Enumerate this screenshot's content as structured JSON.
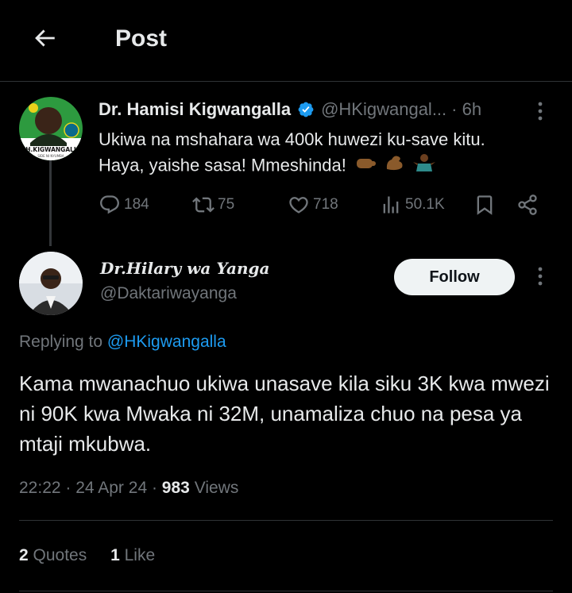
{
  "header": {
    "title": "Post",
    "back_icon": "arrow-left-icon"
  },
  "parent_tweet": {
    "avatar_caption": "H.KIGWANGALI",
    "avatar_subcaption": "SIDE NI NYUMBA",
    "author_name": "Dr. Hamisi Kigwangalla",
    "handle": "@HKigwangal...",
    "time": "· 6h",
    "text_line1": "Ukiwa na mshahara wa 400k huwezi ku-save kitu.",
    "text_line2": "Haya, yaishe sasa! Mmeshinda!",
    "actions": {
      "replies": "184",
      "reposts": "75",
      "likes": "718",
      "views": "50.1K"
    }
  },
  "reply_tweet": {
    "author_name": "Dr.Hilary wa Yanga",
    "handle": "@Daktariwayanga",
    "follow_label": "Follow",
    "replying_prefix": "Replying to",
    "replying_to": "@HKigwangalla",
    "text": "Kama mwanachuo ukiwa unasave kila siku 3K kwa mwezi ni 90K kwa Mwaka ni 32M, unamaliza chuo na pesa ya mtaji mkubwa.",
    "timestamp": "22:22 · 24 Apr 24 ·",
    "views_count": "983",
    "views_label": "Views",
    "quotes_count": "2",
    "quotes_label": "Quotes",
    "likes_count": "1",
    "likes_label": "Like"
  },
  "colors": {
    "background": "#000000",
    "text": "#e7e9ea",
    "muted": "#71767b",
    "link": "#1d9bf0",
    "verified": "#1d9bf0",
    "divider": "#2f3336"
  }
}
